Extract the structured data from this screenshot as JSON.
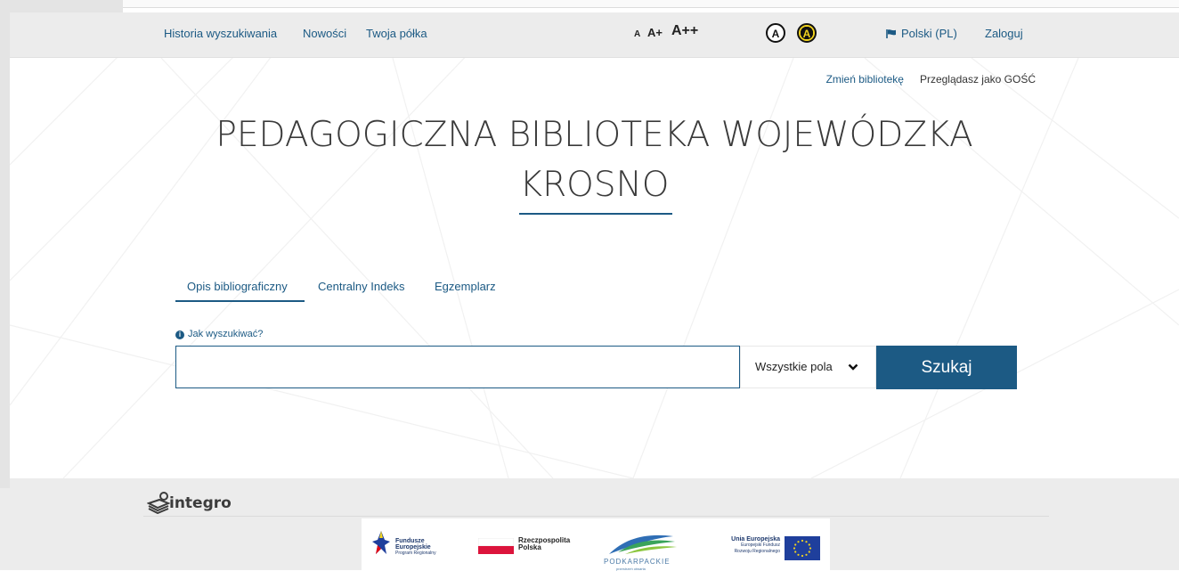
{
  "nav": {
    "history": "Historia wyszukiwania",
    "news": "Nowości",
    "shelf": "Twoja półka",
    "font_small": "A",
    "font_medium": "A+",
    "font_large": "A++",
    "contrast_normal": "A",
    "contrast_high": "A",
    "language": "Polski (PL)",
    "login": "Zaloguj"
  },
  "subheader": {
    "change_library": "Zmień bibliotekę",
    "browsing_as": "Przeglądasz jako GOŚĆ"
  },
  "title": {
    "line1": "PEDAGOGICZNA BIBLIOTEKA WOJEWÓDZKA",
    "line2": "KROSNO"
  },
  "tabs": {
    "items": [
      {
        "label": "Opis bibliograficzny",
        "active": true
      },
      {
        "label": "Centralny Indeks",
        "active": false
      },
      {
        "label": "Egzemplarz",
        "active": false
      }
    ]
  },
  "search": {
    "help": "Jak wyszukiwać?",
    "value": "",
    "field": "Wszystkie pola",
    "button": "Szukaj"
  },
  "footer": {
    "brand": "integro",
    "logos": {
      "fe_line1": "Fundusze",
      "fe_line2": "Europejskie",
      "fe_line3": "Program Regionalny",
      "rp_line1": "Rzeczpospolita",
      "rp_line2": "Polska",
      "pk": "PODKARPACKIE",
      "pk_tagline": "przestrzeń otwarta",
      "ue_line1": "Unia Europejska",
      "ue_line2": "Europejski Fundusz",
      "ue_line3": "Rozwoju Regionalnego"
    }
  },
  "colors": {
    "accent": "#1c5a84",
    "topbar": "#ececec",
    "contrast_yellow": "#f2d41f"
  }
}
